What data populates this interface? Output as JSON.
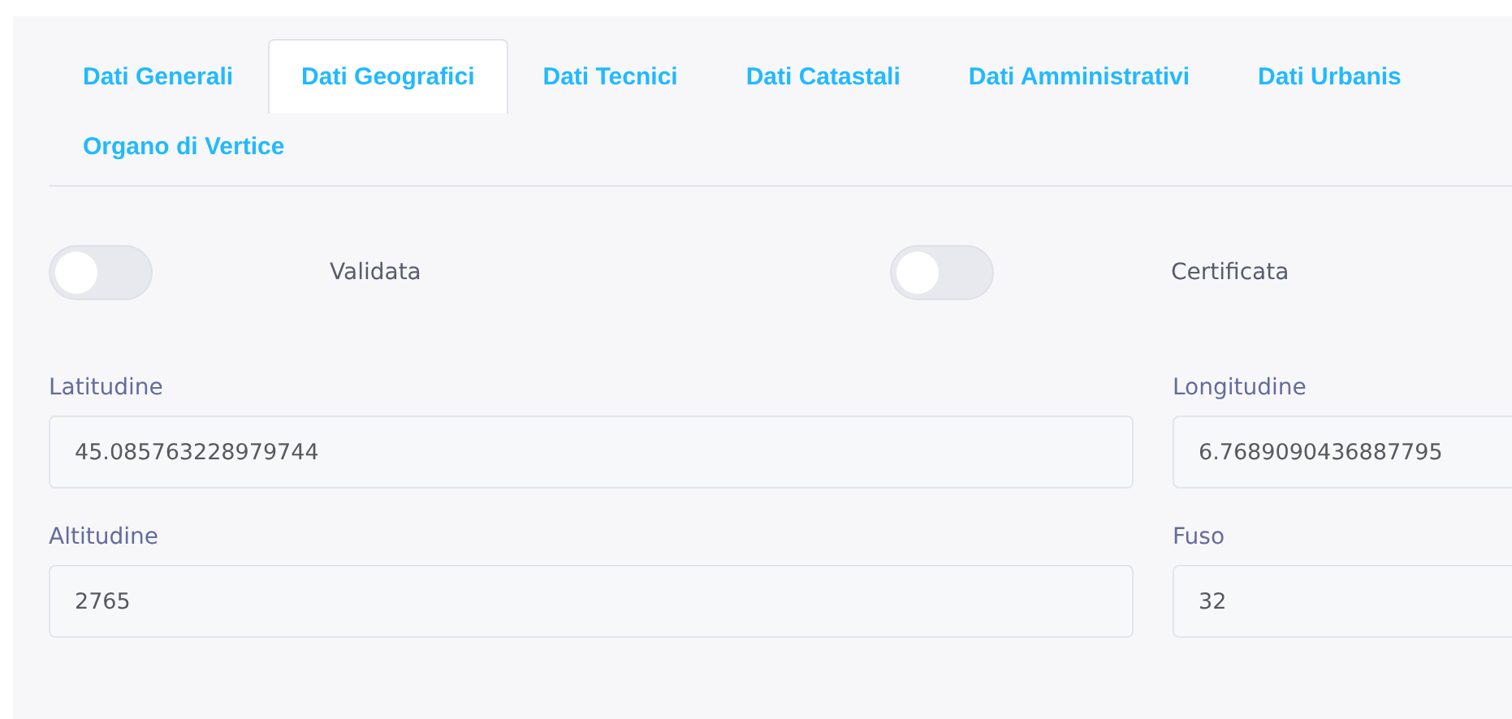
{
  "tabs": [
    {
      "label": "Dati Generali",
      "selected": false
    },
    {
      "label": "Dati Geografici",
      "selected": true
    },
    {
      "label": "Dati Tecnici",
      "selected": false
    },
    {
      "label": "Dati Catastali",
      "selected": false
    },
    {
      "label": "Dati Amministrativi",
      "selected": false
    },
    {
      "label": "Dati Urbanis",
      "selected": false
    },
    {
      "label": "Organo di Vertice",
      "selected": false
    }
  ],
  "toggles": [
    {
      "label": "Validata",
      "on": false
    },
    {
      "label": "Certificata",
      "on": false
    }
  ],
  "fields": [
    {
      "label": "Latitudine",
      "value": "45.085763228979744"
    },
    {
      "label": "Longitudine",
      "value": "6.7689090436887795"
    },
    {
      "label": "Altitudine",
      "value": "2765"
    },
    {
      "label": "Fuso",
      "value": "32"
    }
  ]
}
